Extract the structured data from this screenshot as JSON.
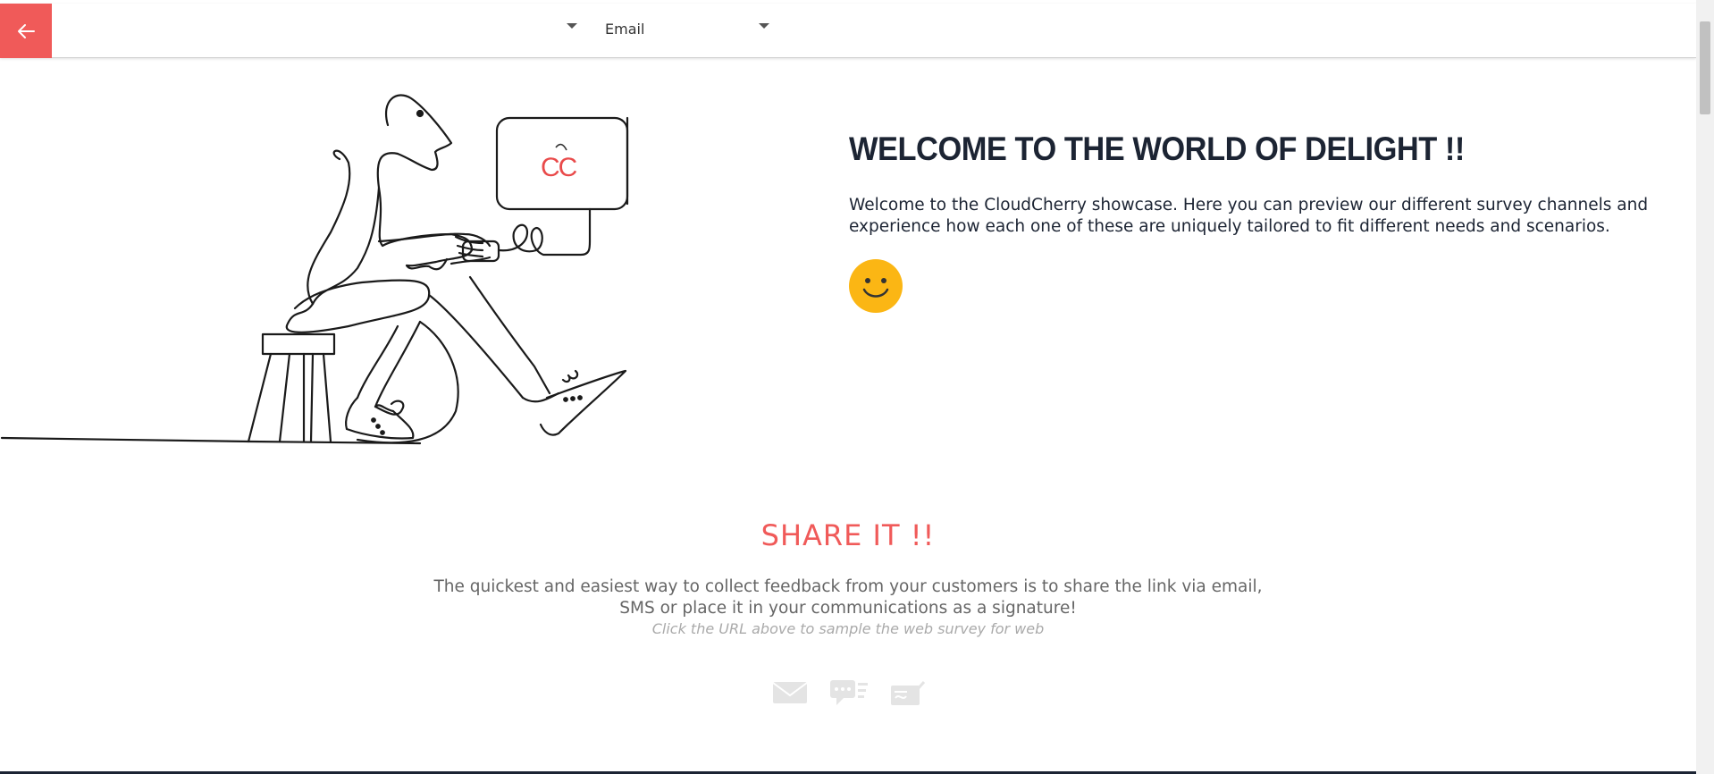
{
  "header": {
    "channel_select_value": "Email",
    "back_icon": "arrow-left-icon",
    "accent_color": "#f05a59"
  },
  "welcome": {
    "title": "WELCOME TO THE WORLD OF DELIGHT !!",
    "description": "Welcome to the CloudCherry showcase. Here you can preview our different survey channels and experience how each one of these are uniquely tailored to fit different needs and scenarios.",
    "icon": "smiley-icon",
    "icon_color": "#fbb614"
  },
  "illustration": {
    "screen_logo": "CC"
  },
  "share": {
    "title": "SHARE IT !!",
    "description": "The quickest and easiest way to collect feedback from your customers is to share the link via email, SMS or place it in your communications as a signature!",
    "hint": "Click the URL above to sample the web survey for web",
    "channels": [
      "email-icon",
      "sms-icon",
      "signature-icon"
    ]
  }
}
